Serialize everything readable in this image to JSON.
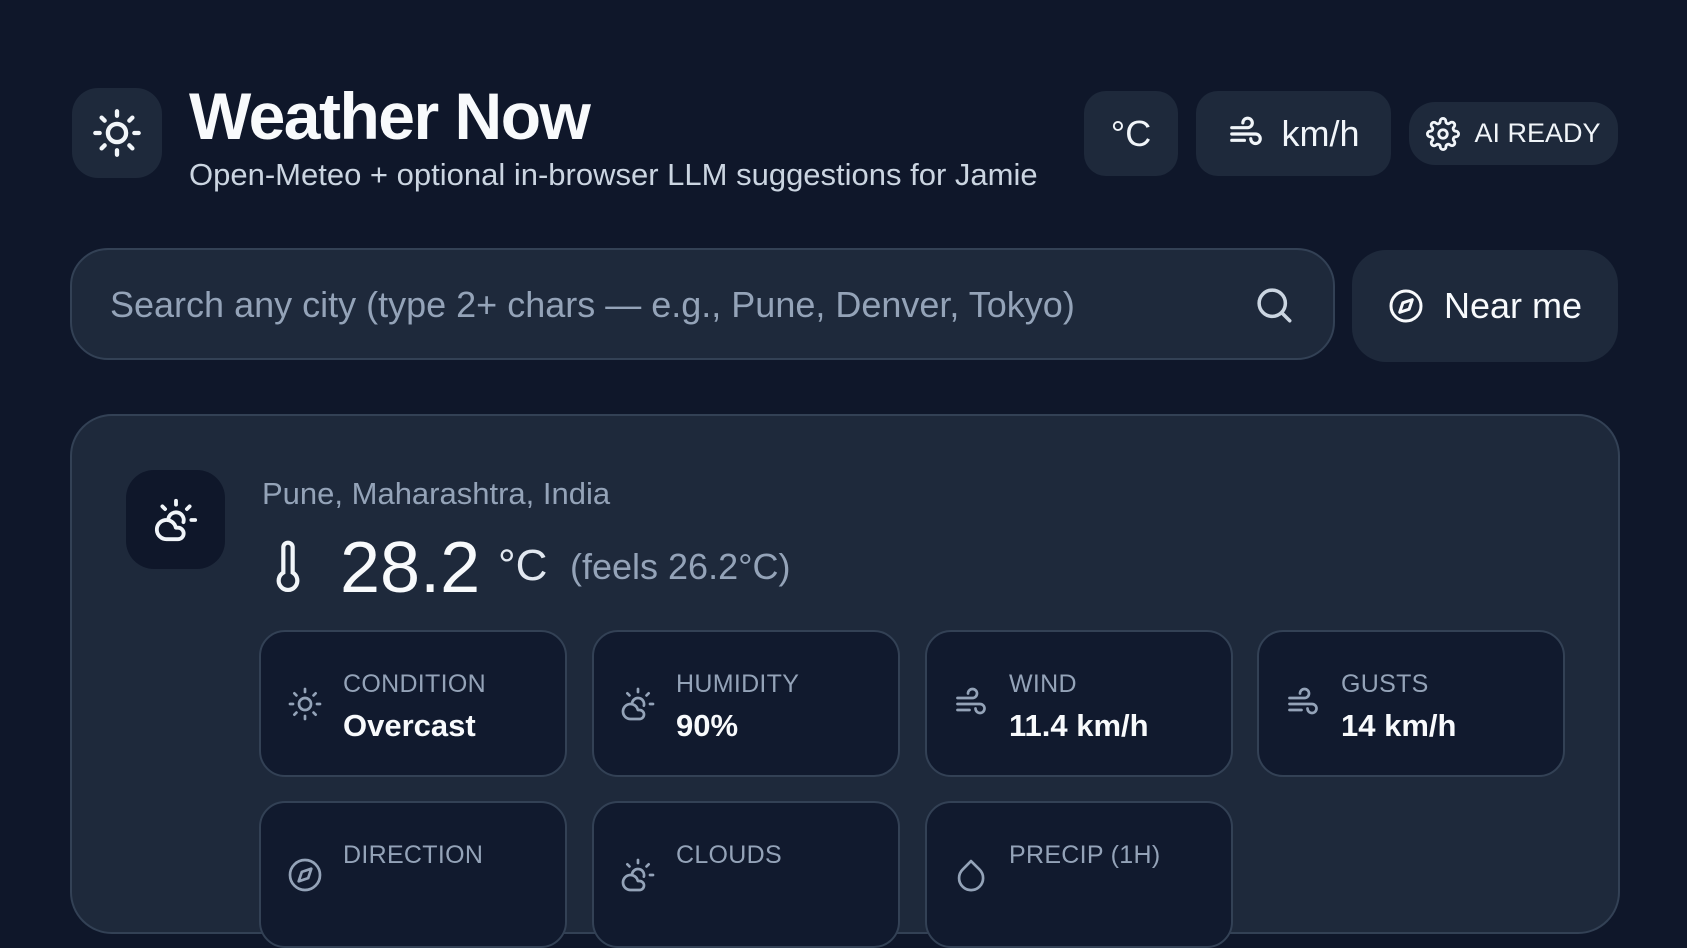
{
  "header": {
    "title": "Weather Now",
    "subtitle": "Open-Meteo + optional in-browser LLM suggestions for Jamie",
    "temp_unit": "°C",
    "wind_unit": "km/h",
    "ai_status": "AI READY"
  },
  "search": {
    "placeholder": "Search any city (type 2+ chars — e.g., Pune, Denver, Tokyo)",
    "value": "",
    "near_me_label": "Near me"
  },
  "current": {
    "location": "Pune, Maharashtra, India",
    "temperature": "28.2",
    "temperature_unit": "°C",
    "feels_like": "(feels 26.2°C)",
    "condition_icon": "partly-cloudy-sun-icon"
  },
  "stats": [
    {
      "label": "CONDITION",
      "value": "Overcast",
      "icon": "sun-icon"
    },
    {
      "label": "HUMIDITY",
      "value": "90%",
      "icon": "cloud-sun-icon"
    },
    {
      "label": "WIND",
      "value": "11.4 km/h",
      "icon": "wind-icon"
    },
    {
      "label": "GUSTS",
      "value": "14 km/h",
      "icon": "wind-icon"
    },
    {
      "label": "DIRECTION",
      "value": "",
      "icon": "compass-icon"
    },
    {
      "label": "CLOUDS",
      "value": "",
      "icon": "cloud-sun-icon"
    },
    {
      "label": "PRECIP (1H)",
      "value": "",
      "icon": "droplet-icon"
    }
  ],
  "colors": {
    "background": "#0f172a",
    "surface": "#1e293b",
    "border": "#334155",
    "text_primary": "#f8fafc",
    "text_muted": "#94a3b8"
  }
}
